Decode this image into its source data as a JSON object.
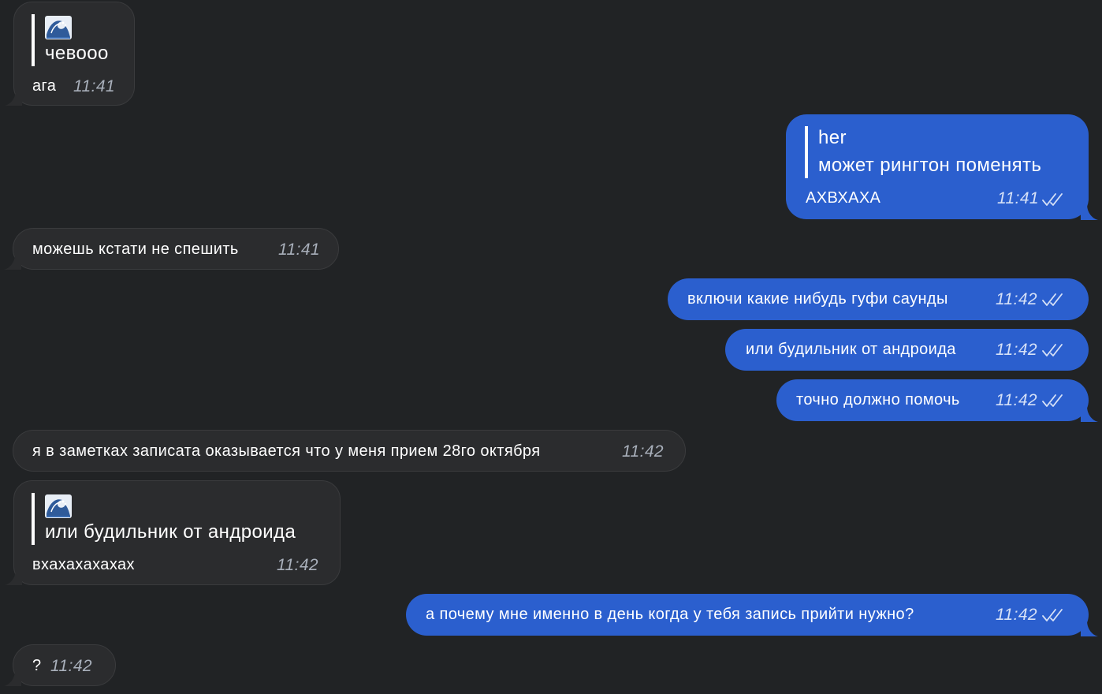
{
  "colors": {
    "background": "#212325",
    "incoming_bubble": "#2b2c2e",
    "outgoing_bubble": "#2b5fce"
  },
  "messages": [
    {
      "direction": "incoming",
      "reply": {
        "author_icon": "wave-emoji",
        "text": "чевооо"
      },
      "text": "ага",
      "time": "11:41"
    },
    {
      "direction": "outgoing",
      "reply": {
        "author": "her",
        "text": "может рингтон поменять"
      },
      "text": "АХВХАХА",
      "time": "11:41",
      "status": "double-check-icon"
    },
    {
      "direction": "incoming",
      "text": "можешь кстати не спешить",
      "time": "11:41"
    },
    {
      "direction": "outgoing",
      "text": "включи какие нибудь гуфи саунды",
      "time": "11:42",
      "status": "double-check-icon"
    },
    {
      "direction": "outgoing",
      "text": "или будильник от андроида",
      "time": "11:42",
      "status": "double-check-icon"
    },
    {
      "direction": "outgoing",
      "text": "точно должно помочь",
      "time": "11:42",
      "status": "double-check-icon"
    },
    {
      "direction": "incoming",
      "text": "я в заметках записата оказывается что у меня прием 28го октября",
      "time": "11:42"
    },
    {
      "direction": "incoming",
      "reply": {
        "author_icon": "wave-emoji",
        "text": "или будильник от андроида"
      },
      "text": "вхахахахахах",
      "time": "11:42"
    },
    {
      "direction": "outgoing",
      "text": "а почему мне именно в день когда у тебя запись прийти нужно?",
      "time": "11:42",
      "status": "double-check-icon"
    },
    {
      "direction": "incoming",
      "text": "?",
      "time": "11:42"
    }
  ]
}
